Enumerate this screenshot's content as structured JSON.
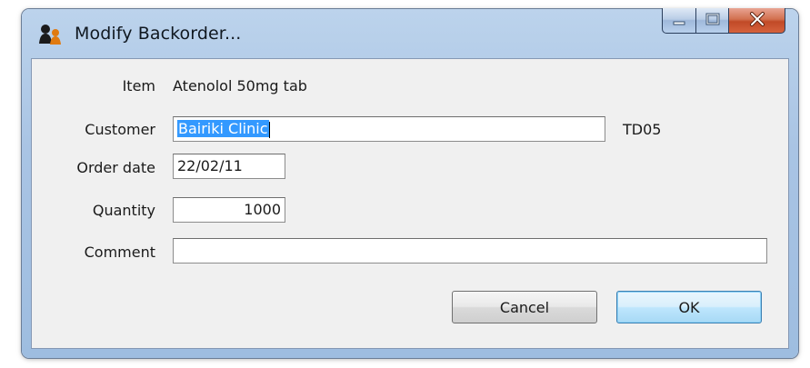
{
  "window": {
    "title": "Modify Backorder...",
    "icon": "people-icon",
    "controls": [
      "minimize-icon",
      "maximize-icon",
      "close-icon"
    ]
  },
  "form": {
    "item": {
      "label": "Item",
      "value": "Atenolol 50mg tab"
    },
    "customer": {
      "label": "Customer",
      "value": "Bairiki Clinic",
      "code": "TD05"
    },
    "order_date": {
      "label": "Order date",
      "value": "22/02/11"
    },
    "quantity": {
      "label": "Quantity",
      "value": "1000"
    },
    "comment": {
      "label": "Comment",
      "value": ""
    }
  },
  "buttons": {
    "cancel_label": "Cancel",
    "ok_label": "OK"
  },
  "colors": {
    "selection": "#3399ff",
    "frame": "#a9c4e4",
    "close_button": "#c14a27"
  }
}
